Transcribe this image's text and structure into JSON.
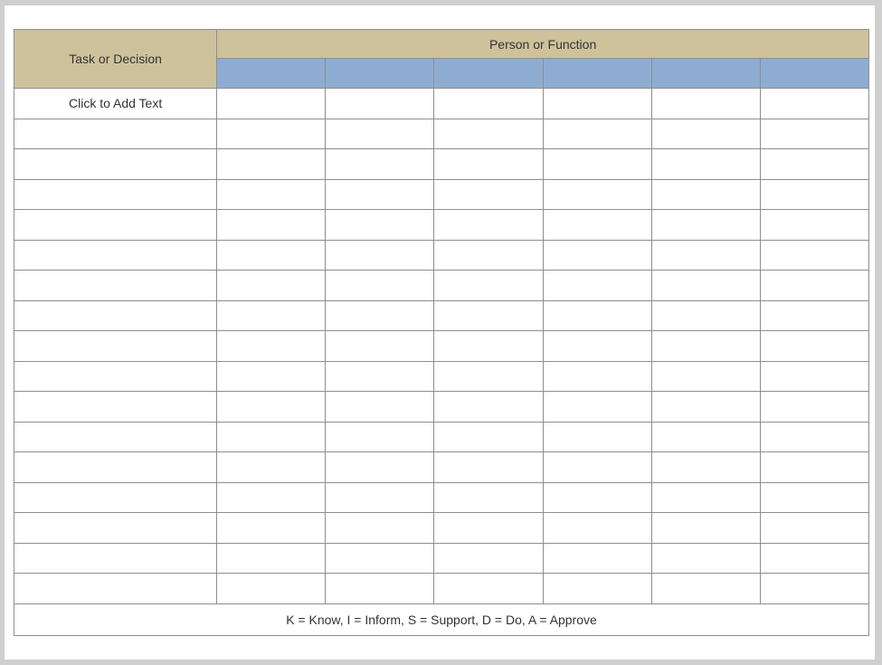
{
  "header": {
    "task_label": "Task or Decision",
    "person_label": "Person or Function"
  },
  "rows": [
    {
      "task": "Click to Add Text"
    },
    {
      "task": ""
    },
    {
      "task": ""
    },
    {
      "task": ""
    },
    {
      "task": ""
    },
    {
      "task": ""
    },
    {
      "task": ""
    },
    {
      "task": ""
    },
    {
      "task": ""
    },
    {
      "task": ""
    },
    {
      "task": ""
    },
    {
      "task": ""
    },
    {
      "task": ""
    },
    {
      "task": ""
    },
    {
      "task": ""
    },
    {
      "task": ""
    },
    {
      "task": ""
    }
  ],
  "legend": "K = Know, I = Inform, S = Support, D = Do, A = Approve",
  "colors": {
    "header_tan": "#cec29c",
    "header_blue": "#8eacd2",
    "grid": "#8e8e8e"
  }
}
